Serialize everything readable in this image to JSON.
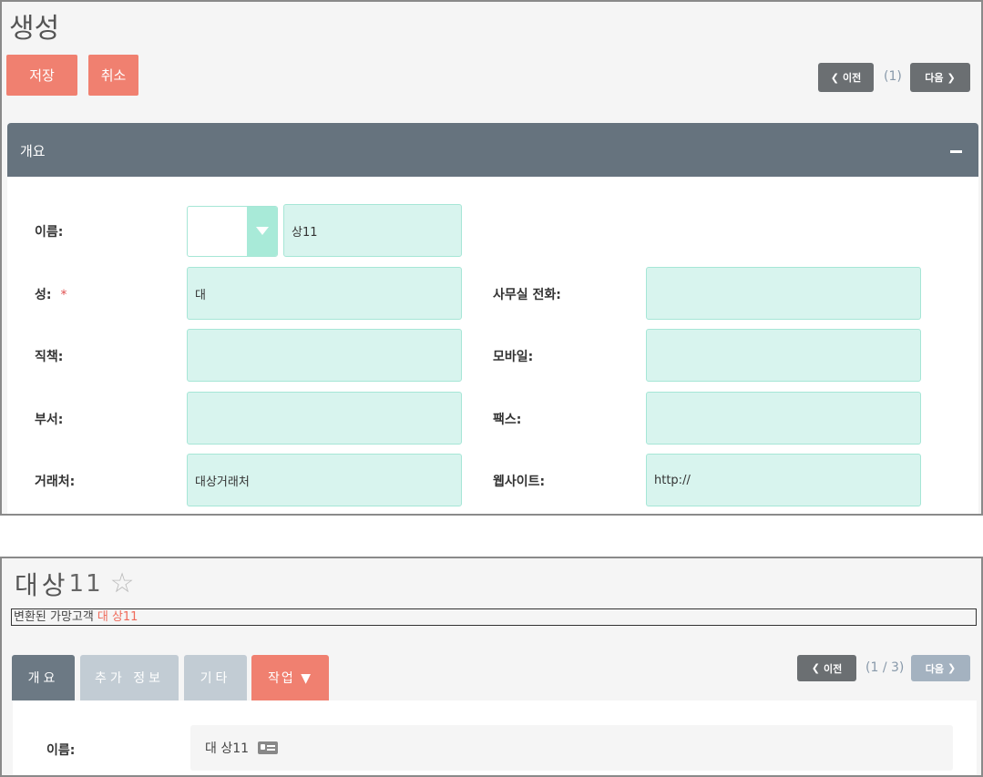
{
  "create": {
    "title": "생성",
    "save_label": "저장",
    "cancel_label": "취소",
    "prev_label": "이전",
    "next_label": "다음",
    "page_indicator": "(1)",
    "section_title": "개요",
    "fields": {
      "name_label": "이름:",
      "name_value": "상11",
      "last_name_label": "성:",
      "last_name_required": "*",
      "last_name_value": "대",
      "title_label": "직책:",
      "title_value": "",
      "department_label": "부서:",
      "department_value": "",
      "account_label": "거래처:",
      "account_value": "대상거래처",
      "office_phone_label": "사무실 전화:",
      "office_phone_value": "",
      "mobile_label": "모바일:",
      "mobile_value": "",
      "fax_label": "팩스:",
      "fax_value": "",
      "website_label": "웹사이트:",
      "website_value": "http://"
    }
  },
  "detail": {
    "title_last": "대",
    "title_first": "상",
    "title_num": "11",
    "converted_text": "변환된 가망고객",
    "converted_link": "대 상11",
    "tabs": {
      "overview": "개요",
      "more_info": "추가 정보",
      "other": "기타",
      "actions": "작업 ▼"
    },
    "prev_label": "이전",
    "next_label": "다음",
    "page_indicator": "(1 / 3)",
    "name_label": "이름:",
    "name_value": "대 상11"
  },
  "colors": {
    "accent_red": "#f08070",
    "header_slate": "#66737e",
    "field_mint": "#d8f4ee"
  }
}
